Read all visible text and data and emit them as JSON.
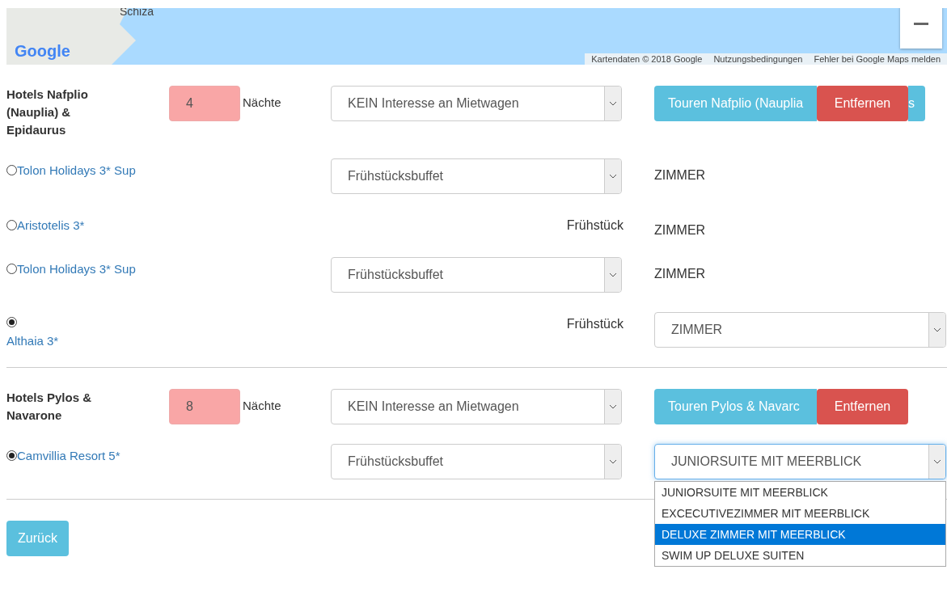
{
  "map": {
    "place_label": "Schiza",
    "logo": "Google",
    "attribution": [
      "Kartendaten © 2018 Google",
      "Nutzungsbedingungen",
      "Fehler bei Google Maps melden"
    ]
  },
  "groups": [
    {
      "title": "Hotels Nafplio (Nauplia) & Epidaurus",
      "nights": "4",
      "nights_label": "Nächte",
      "car": "KEIN Interesse an Mietwagen",
      "tours": "Touren Nafplio (Nauplia",
      "tours_tail": "s",
      "remove": "Entfernen",
      "hotels": [
        {
          "name": "Tolon Holidays 3* Sup",
          "selected": false,
          "stacked": false,
          "meal": {
            "kind": "select",
            "value": "Frühstücksbuffet"
          },
          "room": {
            "kind": "text",
            "value": "ZIMMER"
          }
        },
        {
          "name": "Aristotelis 3*",
          "selected": false,
          "stacked": false,
          "meal": {
            "kind": "text",
            "value": "Frühstück"
          },
          "room": {
            "kind": "text",
            "value": "ZIMMER"
          }
        },
        {
          "name": "Tolon Holidays 3* Sup",
          "selected": false,
          "stacked": false,
          "meal": {
            "kind": "select",
            "value": "Frühstücksbuffet"
          },
          "room": {
            "kind": "text",
            "value": "ZIMMER"
          }
        },
        {
          "name": "Althaia 3*",
          "selected": true,
          "stacked": true,
          "meal": {
            "kind": "text",
            "value": "Frühstück"
          },
          "room": {
            "kind": "select",
            "value": "ZIMMER"
          }
        }
      ]
    },
    {
      "title": "Hotels Pylos & Navarone",
      "nights": "8",
      "nights_label": "Nächte",
      "car": "KEIN Interesse an Mietwagen",
      "tours": "Touren Pylos & Navarc",
      "remove": "Entfernen",
      "hotels": [
        {
          "name": "Camvillia Resort 5*",
          "selected": true,
          "stacked": false,
          "meal": {
            "kind": "select",
            "value": "Frühstücksbuffet"
          },
          "room": {
            "kind": "select",
            "value": "JUNIORSUITE MIT MEERBLICK",
            "options": [
              {
                "label": "JUNIORSUITE MIT MEERBLICK",
                "highlighted": false
              },
              {
                "label": "EXCECUTIVEZIMMER MIT MEERBLICK",
                "highlighted": false
              },
              {
                "label": "DELUXE ZIMMER MIT MEERBLICK",
                "highlighted": true
              },
              {
                "label": "SWIM UP DELUXE SUITEN",
                "highlighted": false
              }
            ]
          }
        }
      ]
    }
  ],
  "back_button": "Zurück"
}
